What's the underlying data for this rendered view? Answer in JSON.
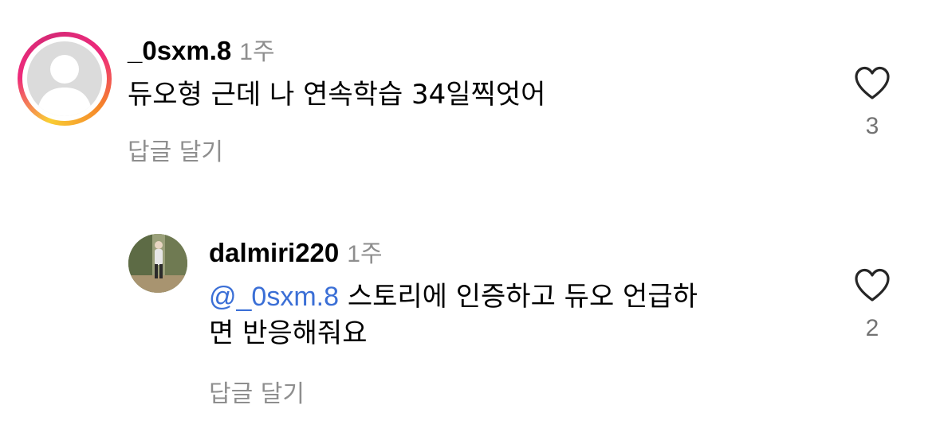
{
  "comments": [
    {
      "username": "_0sxm.8",
      "time": "1주",
      "text": "듀오형 근데 나 연속학습 34일찍엇어",
      "reply_label": "답글 달기",
      "likes": "3",
      "avatar": "default-avatar-icon",
      "has_story_ring": true
    }
  ],
  "replies": [
    {
      "username": "dalmiri220",
      "time": "1주",
      "mention": "@_0sxm.8",
      "text_line1": " 스토리에 인증하고 듀오 언급하",
      "text_line2": "면 반응해줘요",
      "reply_label": "답글 달기",
      "likes": "2",
      "avatar": "photo-avatar"
    }
  ],
  "colors": {
    "secondary_text": "#8e8e8e",
    "mention": "#3b6fd6",
    "like_icon": "#262626"
  }
}
